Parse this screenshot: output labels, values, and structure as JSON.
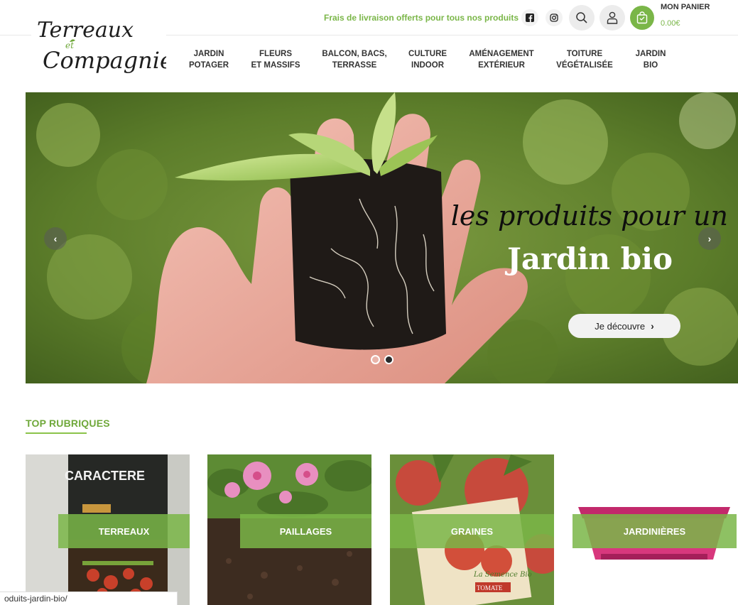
{
  "header": {
    "logo": {
      "line1": "Terreaux",
      "et": "et",
      "line2": "Compagnie"
    },
    "promo": "Frais de livraison offerts pour tous nos produits",
    "icons": [
      "facebook-icon",
      "instagram-icon",
      "search-icon",
      "user-icon",
      "cart-icon"
    ],
    "cart": {
      "title": "MON PANIER",
      "amount": "0.00€"
    }
  },
  "nav": {
    "items": [
      {
        "label": "JARDIN\nPOTAGER"
      },
      {
        "label": "FLEURS\nET MASSIFS"
      },
      {
        "label": "BALCON, BACS,\nTERRASSE"
      },
      {
        "label": "CULTURE\nINDOOR"
      },
      {
        "label": "AMÉNAGEMENT\nEXTÉRIEUR"
      },
      {
        "label": "TOITURE\nVÉGÉTALISÉE"
      },
      {
        "label": "JARDIN\nBIO"
      }
    ]
  },
  "hero": {
    "line1": "les produits pour un",
    "line2": "Jardin bio",
    "cta": "Je découvre",
    "cta_icon": "chevron-right-icon",
    "prev_icon": "chevron-left-icon",
    "next_icon": "chevron-right-icon",
    "slides": 2,
    "active_slide": 2
  },
  "section": {
    "title": "TOP RUBRIQUES",
    "cards": [
      {
        "label": "TERREAUX",
        "image_text": "CARACTERE"
      },
      {
        "label": "PAILLAGES"
      },
      {
        "label": "GRAINES"
      },
      {
        "label": "JARDINIÈRES"
      }
    ]
  },
  "status_bar": {
    "url": "oduits-jardin-bio/"
  },
  "colors": {
    "brand_green": "#7ab648",
    "text_dark": "#333333",
    "white": "#ffffff"
  }
}
